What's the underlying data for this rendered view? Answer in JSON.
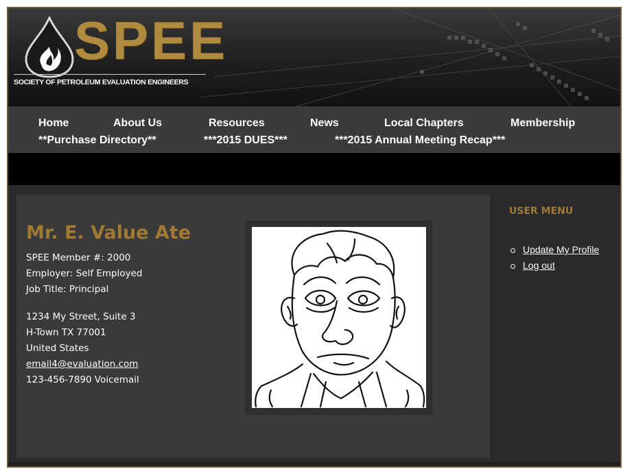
{
  "header": {
    "logo_text": "SPEE",
    "logo_subtitle": "SOCIETY OF PETROLEUM EVALUATION ENGINEERS"
  },
  "nav": {
    "row1": [
      "Home",
      "About Us",
      "Resources",
      "News",
      "Local Chapters",
      "Membership"
    ],
    "row2": [
      "**Purchase Directory**",
      "***2015 DUES***",
      "***2015 Annual Meeting Recap***"
    ]
  },
  "profile": {
    "name": "Mr. E. Value Ate",
    "member_no": "SPEE Member #: 2000",
    "employer": "Employer: Self Employed",
    "job_title": "Job Title: Principal",
    "address1": "1234 My Street, Suite 3",
    "address2": "H-Town TX 77001",
    "country": "United States",
    "email": "email4@evaluation.com",
    "phone": "123-456-7890 Voicemail"
  },
  "user_menu": {
    "title": "USER MENU",
    "items": [
      "Update My Profile",
      "Log out"
    ]
  },
  "colors": {
    "accent_gold": "#a07a35",
    "background_dark": "#2a2a2a",
    "panel": "#3a3a3a"
  }
}
